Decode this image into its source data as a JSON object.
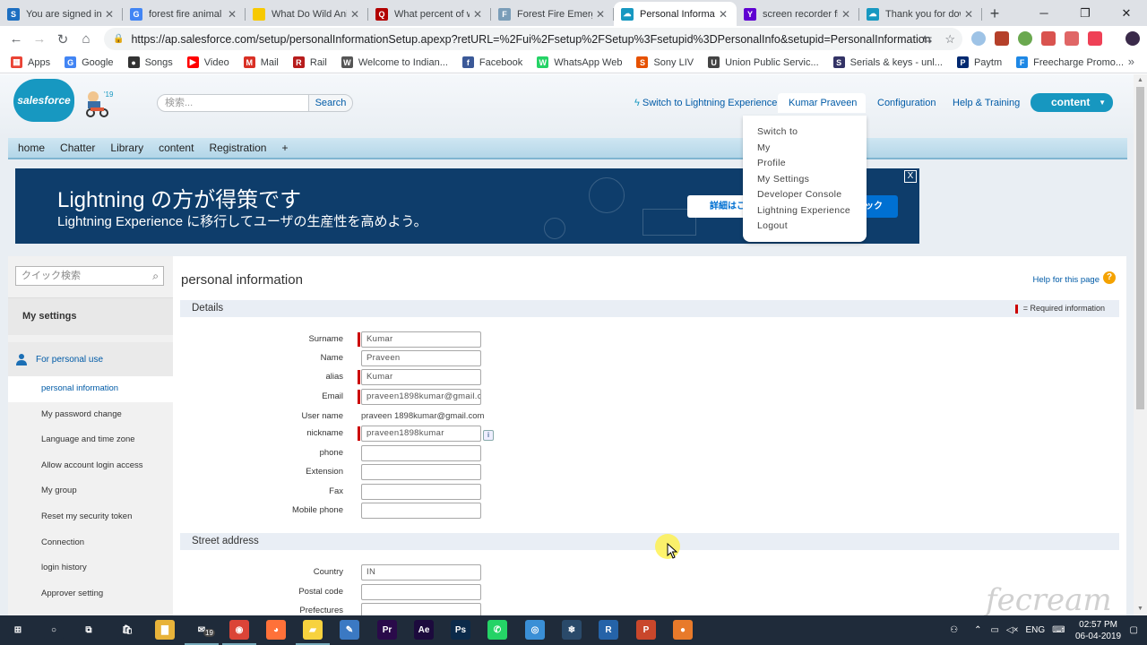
{
  "browser": {
    "tabs": [
      {
        "title": "You are signed in a",
        "favicon_color": "#1d6fc1",
        "favicon_glyph": "S"
      },
      {
        "title": "forest fire animal d",
        "favicon_color": "#4285f4",
        "favicon_glyph": "G"
      },
      {
        "title": "What Do Wild Anim",
        "favicon_color": "#f7c900",
        "favicon_glyph": ""
      },
      {
        "title": "What percent of wi",
        "favicon_color": "#b20000",
        "favicon_glyph": "Q"
      },
      {
        "title": "Forest Fire Emerge",
        "favicon_color": "#7a9db8",
        "favicon_glyph": "F"
      },
      {
        "title": "Personal Informatio",
        "favicon_color": "#1798c1",
        "favicon_glyph": "☁"
      },
      {
        "title": "screen recorder file",
        "favicon_color": "#5f01d1",
        "favicon_glyph": "Y"
      },
      {
        "title": "Thank you for dow",
        "favicon_color": "#1798c1",
        "favicon_glyph": "☁"
      }
    ],
    "active_tab_index": 5,
    "url": "https://ap.salesforce.com/setup/personalInformationSetup.apexp?retURL=%2Fui%2Fsetup%2FSetup%3Fsetupid%3DPersonalInfo&setupid=PersonalInformation",
    "bookmarks": [
      {
        "label": "Apps",
        "color": "#ea4335",
        "glyph": "▦"
      },
      {
        "label": "Google",
        "color": "#4285f4",
        "glyph": "G"
      },
      {
        "label": "Songs",
        "color": "#333333",
        "glyph": "●"
      },
      {
        "label": "Video",
        "color": "#ff0000",
        "glyph": "▶"
      },
      {
        "label": "Mail",
        "color": "#d93025",
        "glyph": "M"
      },
      {
        "label": "Rail",
        "color": "#b71c1c",
        "glyph": "R"
      },
      {
        "label": "Welcome to Indian...",
        "color": "#555555",
        "glyph": "W"
      },
      {
        "label": "Facebook",
        "color": "#3b5998",
        "glyph": "f"
      },
      {
        "label": "WhatsApp Web",
        "color": "#25d366",
        "glyph": "W"
      },
      {
        "label": "Sony LIV",
        "color": "#e65100",
        "glyph": "S"
      },
      {
        "label": "Union Public Servic...",
        "color": "#444444",
        "glyph": "U"
      },
      {
        "label": "Serials & keys - unl...",
        "color": "#333366",
        "glyph": "S"
      },
      {
        "label": "Paytm",
        "color": "#002970",
        "glyph": "P"
      },
      {
        "label": "Freecharge Promo...",
        "color": "#1e88e5",
        "glyph": "F"
      }
    ],
    "bookmarks_more": "»"
  },
  "sf": {
    "logo_text": "salesforce",
    "mascot_badge": "'19",
    "search_placeholder": "検索...",
    "search_button": "Search",
    "switch_lightning": "Switch to Lightning Experience",
    "user_name": "Kumar Praveen",
    "configuration": "Configuration",
    "help_training": "Help & Training",
    "app_name": "content",
    "user_menu_items": [
      "Switch to",
      "My",
      "Profile",
      "My Settings",
      "Developer Console",
      "Lightning Experience",
      "Logout"
    ],
    "tabs": [
      "home",
      "Chatter",
      "Library",
      "content",
      "Registration",
      "+"
    ],
    "banner_title": "Lightning の方が得策です",
    "banner_subtitle": "Lightning Experience に移行してユーザの生産性を高めよう。",
    "banner_btn1": "詳細はこ",
    "banner_btn2": "ック",
    "banner_close": "X"
  },
  "sidebar": {
    "quick_search_placeholder": "クイック検索",
    "header": "My settings",
    "section": "For personal use",
    "items": [
      "personal information",
      "My password change",
      "Language and time zone",
      "Allow account login access",
      "My group",
      "Reset my security token",
      "Connection",
      "login history",
      "Approver setting"
    ],
    "active_index": 0
  },
  "content": {
    "title": "personal information",
    "help_link": "Help for this page",
    "details_header": "Details",
    "required_note": "= Required information",
    "street_header": "Street address",
    "fields": [
      {
        "label": "Surname",
        "value": "Kumar",
        "required": true,
        "type": "input"
      },
      {
        "label": "Name",
        "value": "Praveen",
        "required": false,
        "type": "input"
      },
      {
        "label": "alias",
        "value": "Kumar",
        "required": true,
        "type": "input"
      },
      {
        "label": "Email",
        "value": "praveen1898kumar@gmail.c",
        "required": true,
        "type": "input"
      },
      {
        "label": "User name",
        "value": "praveen 1898kumar@gmail.com",
        "required": false,
        "type": "text"
      },
      {
        "label": "nickname",
        "value": "praveen1898kumar",
        "required": true,
        "type": "input",
        "info": "i"
      },
      {
        "label": "phone",
        "value": "",
        "required": false,
        "type": "input"
      },
      {
        "label": "Extension",
        "value": "",
        "required": false,
        "type": "input"
      },
      {
        "label": "Fax",
        "value": "",
        "required": false,
        "type": "input"
      },
      {
        "label": "Mobile phone",
        "value": "",
        "required": false,
        "type": "input"
      }
    ],
    "address_fields": [
      {
        "label": "Country",
        "value": "IN"
      },
      {
        "label": "Postal code",
        "value": ""
      },
      {
        "label": "Prefectures",
        "value": ""
      }
    ]
  },
  "taskbar": {
    "time": "02:57 PM",
    "date": "06-04-2019",
    "lang": "ENG",
    "mail_badge": "19",
    "apps": [
      {
        "name": "start",
        "glyph": "⊞",
        "color": "#1f2b3a"
      },
      {
        "name": "search",
        "glyph": "○",
        "color": "#1f2b3a"
      },
      {
        "name": "task-view",
        "glyph": "⧉",
        "color": "#1f2b3a"
      },
      {
        "name": "store",
        "glyph": "🛍",
        "color": "#1f2b3a"
      },
      {
        "name": "explorer",
        "glyph": "▇",
        "color": "#e8b33a"
      },
      {
        "name": "mail",
        "glyph": "✉",
        "color": "#1f2b3a"
      },
      {
        "name": "chrome",
        "glyph": "◉",
        "color": "#db4437"
      },
      {
        "name": "firefox",
        "glyph": "◕",
        "color": "#ff7139"
      },
      {
        "name": "sticky",
        "glyph": "▰",
        "color": "#f7d23e"
      },
      {
        "name": "paint",
        "glyph": "✎",
        "color": "#3b79c3"
      },
      {
        "name": "premiere",
        "glyph": "Pr",
        "color": "#2a0a4a"
      },
      {
        "name": "after-effects",
        "glyph": "Ae",
        "color": "#1c0a3d"
      },
      {
        "name": "photoshop",
        "glyph": "Ps",
        "color": "#0b2a4a"
      },
      {
        "name": "whatsapp",
        "glyph": "✆",
        "color": "#25d366"
      },
      {
        "name": "instagram",
        "glyph": "◎",
        "color": "#3a8fd6"
      },
      {
        "name": "snow",
        "glyph": "❄",
        "color": "#2a4a6a"
      },
      {
        "name": "r-app",
        "glyph": "R",
        "color": "#2563a8"
      },
      {
        "name": "powerpoint",
        "glyph": "P",
        "color": "#c9472b"
      },
      {
        "name": "recorder",
        "glyph": "●",
        "color": "#e87a2a"
      }
    ],
    "watermark": "fecream"
  }
}
